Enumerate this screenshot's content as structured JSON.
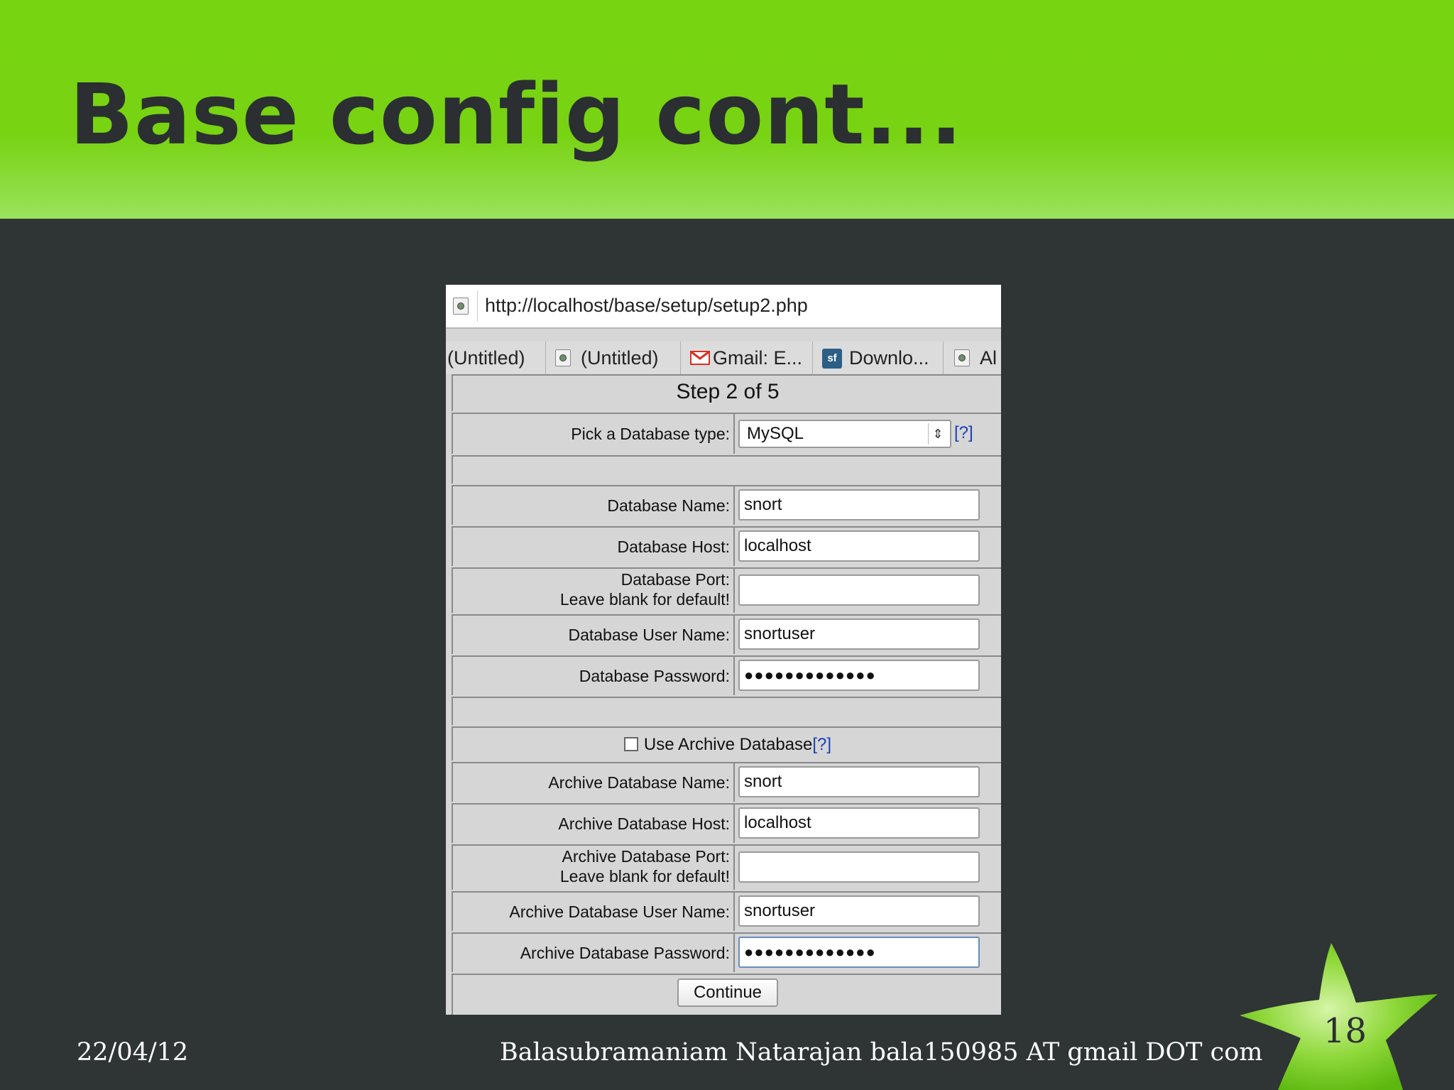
{
  "slide": {
    "title": "Base config cont...",
    "date": "22/04/12",
    "author": "Balasubramaniam Natarajan bala150985 AT gmail DOT com",
    "page_number": "18"
  },
  "browser": {
    "url": "http://localhost/base/setup/setup2.php",
    "tabs": [
      {
        "label": "(Untitled)",
        "icon": "none"
      },
      {
        "label": "(Untitled)",
        "icon": "page-icon"
      },
      {
        "label": "Gmail: E...",
        "icon": "gmail-icon"
      },
      {
        "label": "Downlo...",
        "icon": "sourceforge-icon"
      },
      {
        "label": "Al",
        "icon": "page-icon"
      }
    ]
  },
  "form": {
    "step": "Step 2 of 5",
    "db_type_label": "Pick a Database type:",
    "db_type_value": "MySQL",
    "help": "[?]",
    "db_name_label": "Database Name:",
    "db_name": "snort",
    "db_host_label": "Database Host:",
    "db_host": "localhost",
    "db_port_label_1": "Database Port:",
    "db_port_label_2": "Leave blank for default!",
    "db_port": "",
    "db_user_label": "Database User Name:",
    "db_user": "snortuser",
    "db_pass_label": "Database Password:",
    "db_pass": "●●●●●●●●●●●●●",
    "archive_checkbox_label": "Use Archive Database",
    "archive_checked": false,
    "arch_name_label": "Archive Database Name:",
    "arch_name": "snort",
    "arch_host_label": "Archive Database Host:",
    "arch_host": "localhost",
    "arch_port_label_1": "Archive Database Port:",
    "arch_port_label_2": "Leave blank for default!",
    "arch_port": "",
    "arch_user_label": "Archive Database User Name:",
    "arch_user": "snortuser",
    "arch_pass_label": "Archive Database Password:",
    "arch_pass": "●●●●●●●●●●●●●",
    "continue_label": "Continue"
  }
}
